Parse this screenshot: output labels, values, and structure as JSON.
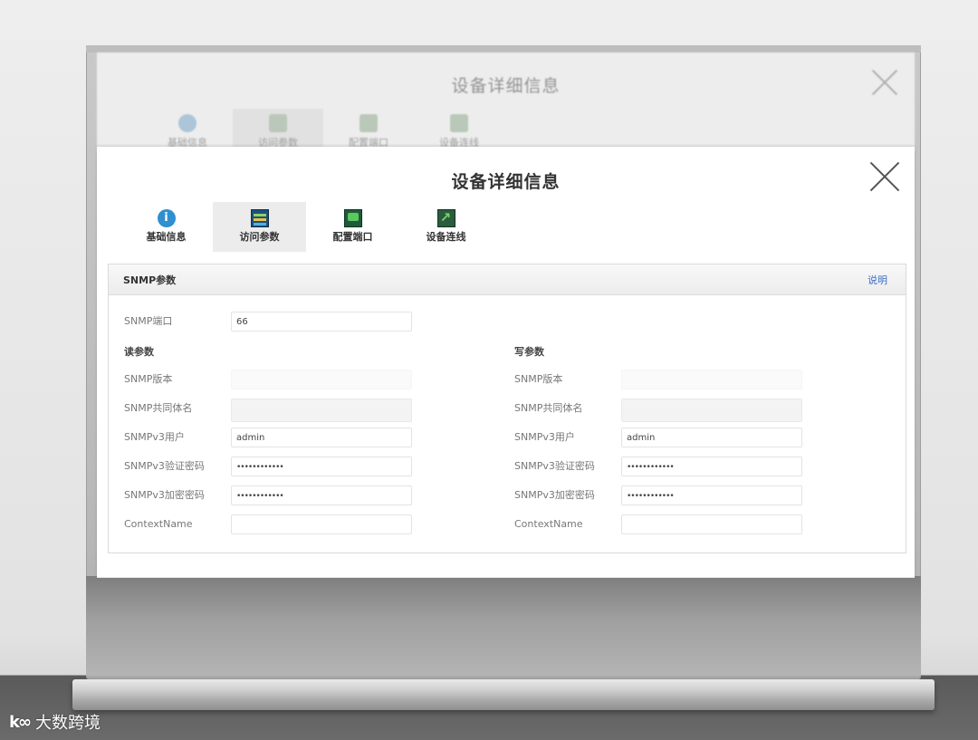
{
  "background_window": {
    "title": "设备详细信息",
    "tabs": [
      {
        "label": "基础信息"
      },
      {
        "label": "访问参数"
      },
      {
        "label": "配置端口"
      },
      {
        "label": "设备连线"
      }
    ]
  },
  "dialog": {
    "title": "设备详细信息",
    "tabs": [
      {
        "label": "基础信息",
        "icon": "info-icon"
      },
      {
        "label": "访问参数",
        "icon": "access-params-icon",
        "active": true
      },
      {
        "label": "配置端口",
        "icon": "config-port-icon"
      },
      {
        "label": "设备连线",
        "icon": "device-link-icon"
      }
    ],
    "panel": {
      "title": "SNMP参数",
      "help_link": "说明",
      "snmp_port": {
        "label": "SNMP端口",
        "value": "66"
      },
      "read": {
        "section_label": "读参数",
        "version_label": "SNMP版本",
        "community_label": "SNMP共同体名",
        "v3_user_label": "SNMPv3用户",
        "v3_user_value": "admin",
        "v3_auth_label": "SNMPv3验证密码",
        "v3_auth_value": "••••••••••••",
        "v3_priv_label": "SNMPv3加密密码",
        "v3_priv_value": "••••••••••••",
        "context_label": "ContextName",
        "context_value": ""
      },
      "write": {
        "section_label": "写参数",
        "version_label": "SNMP版本",
        "community_label": "SNMP共同体名",
        "v3_user_label": "SNMPv3用户",
        "v3_user_value": "admin",
        "v3_auth_label": "SNMPv3验证密码",
        "v3_auth_value": "••••••••••••",
        "v3_priv_label": "SNMPv3加密密码",
        "v3_priv_value": "••••••••••••",
        "context_label": "ContextName",
        "context_value": ""
      }
    }
  },
  "watermark": {
    "logo": "k∞",
    "text": "大数跨境"
  }
}
